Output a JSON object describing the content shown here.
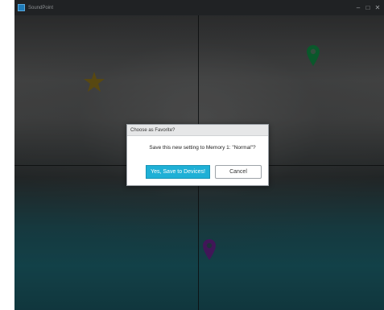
{
  "window": {
    "title": "SoundPoint",
    "controls": [
      "–",
      "□",
      "✕"
    ]
  },
  "canvas": {
    "markers": [
      {
        "name": "star-icon",
        "color": "#7a6418"
      },
      {
        "name": "map-pin-icon",
        "color": "#0f7a3c"
      },
      {
        "name": "map-pin-icon",
        "color": "#5a1f7a"
      }
    ]
  },
  "dialog": {
    "title": "Choose as Favorite?",
    "message": "Save this new setting to Memory 1: \"Normal\"?",
    "confirm_label": "Yes, Save to Devices!",
    "cancel_label": "Cancel",
    "accent_color": "#1fb0d6"
  }
}
